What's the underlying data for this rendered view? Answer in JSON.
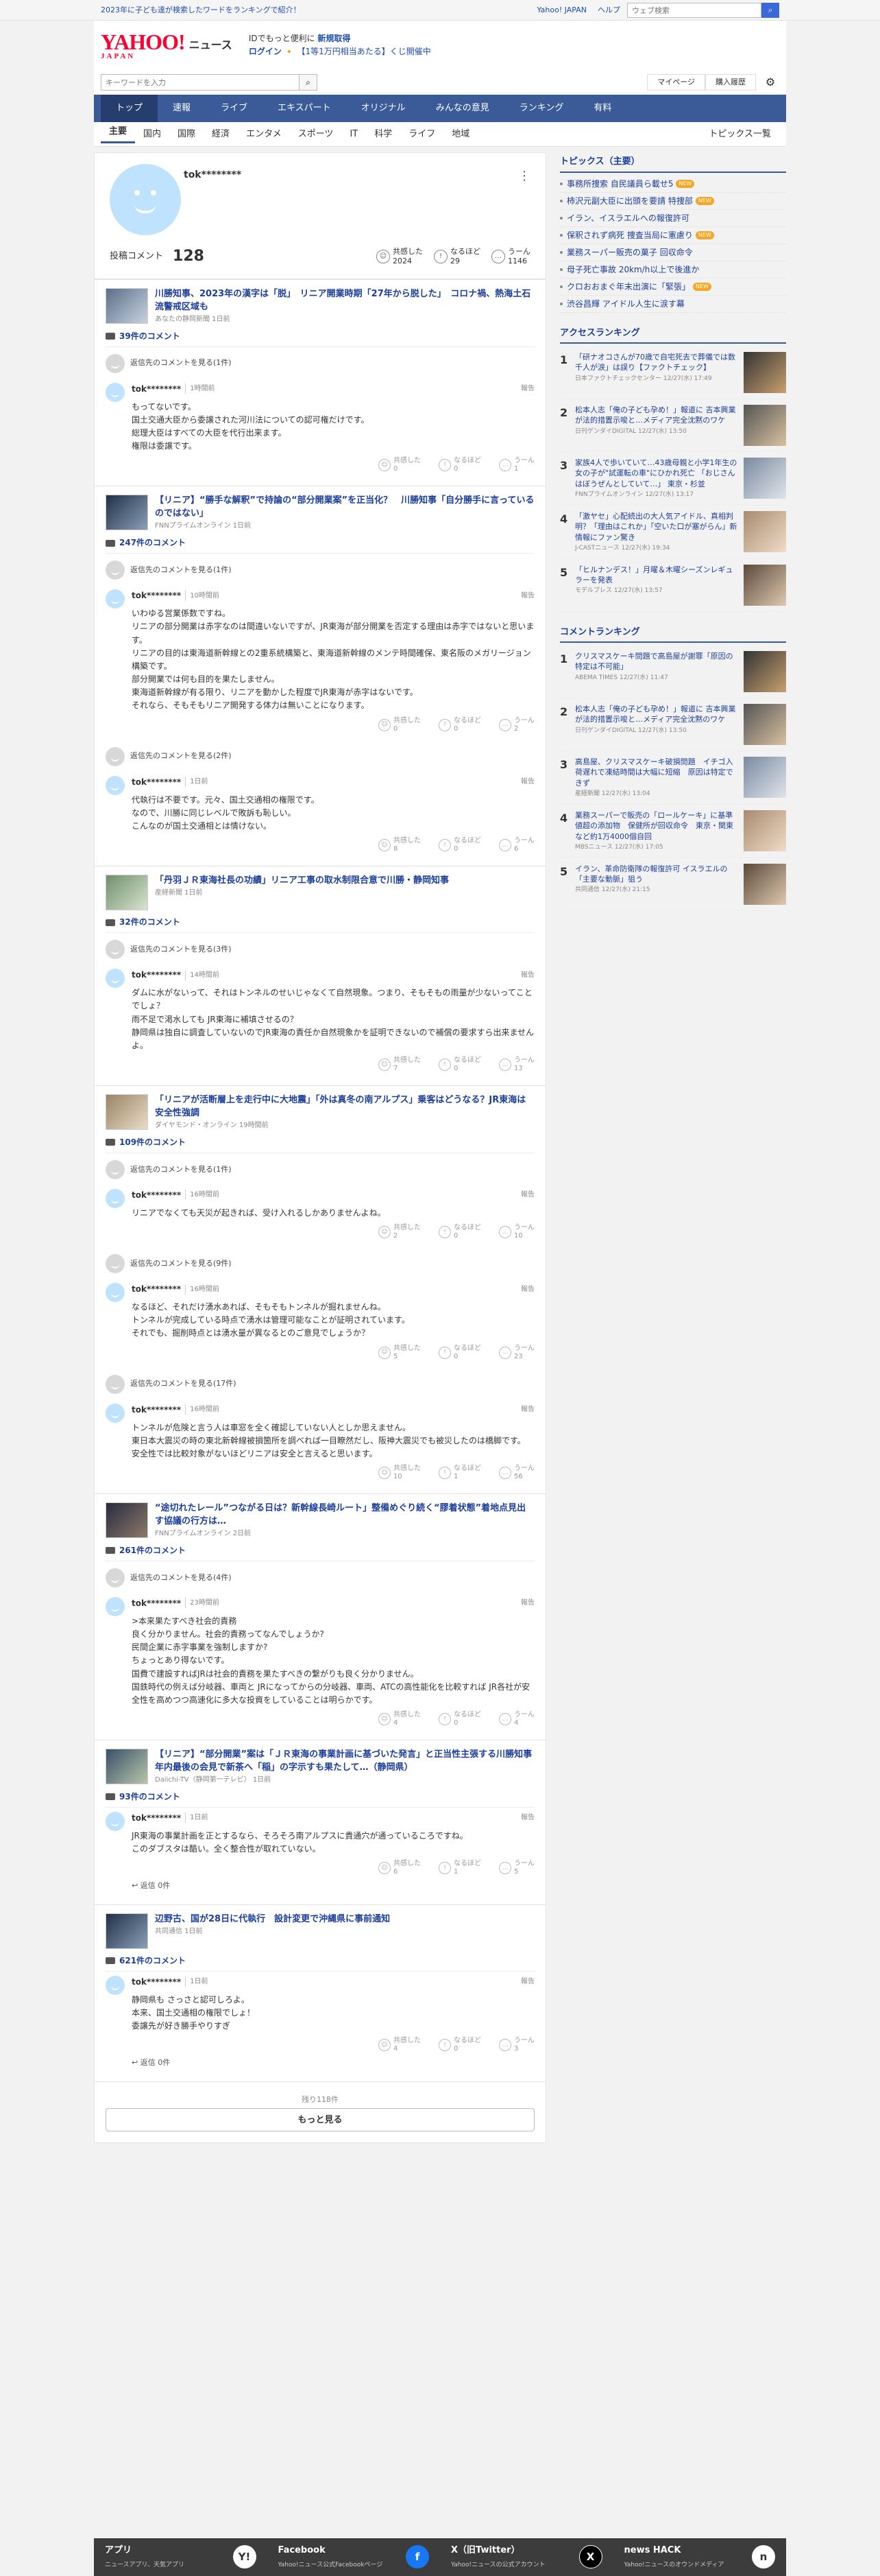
{
  "topbar": {
    "promo": "2023年に子ども達が検索したワードをランキングで紹介！",
    "links": [
      "Yahoo! JAPAN",
      "ヘルプ"
    ],
    "search_placeholder": "ウェブ検索",
    "search_btn": "検索"
  },
  "header": {
    "logo": "YAHOO!",
    "logo_sub": "JAPAN",
    "service": "ニュース",
    "promo_l1a": "IDでもっと便利に",
    "promo_l1b": "新規取得",
    "promo_l2a": "ログイン",
    "promo_l2b": "【1等1万円相当あたる】くじ開催中"
  },
  "searchrow": {
    "placeholder": "キーワードを入力",
    "mypage": "マイページ",
    "purchase": "購入履歴"
  },
  "nav": [
    "トップ",
    "速報",
    "ライブ",
    "エキスパート",
    "オリジナル",
    "みんなの意見",
    "ランキング",
    "有料"
  ],
  "subnav": [
    "主要",
    "国内",
    "国際",
    "経済",
    "エンタメ",
    "スポーツ",
    "IT",
    "科学",
    "ライフ",
    "地域"
  ],
  "subnav_all": "トピックス一覧",
  "profile": {
    "name": "tok********",
    "stat_label": "投稿コメント",
    "stat_count": "128",
    "r1_label": "共感した",
    "r1_val": "2024",
    "r2_label": "なるほど",
    "r2_val": "29",
    "r3_label": "うーん",
    "r3_val": "1146"
  },
  "labels": {
    "reply_view_prefix": "返信先のコメントを見る",
    "report": "報告",
    "react1": "共感した",
    "react2": "なるほど",
    "react3": "うーん",
    "reply_count": "返信 0件"
  },
  "articles": [
    {
      "title": "川勝知事、2023年の漢字は「脱」　リニア開業時期「27年から脱した」　コロナ禍、熱海土石流警戒区域も",
      "src": "あなたの静岡新聞 1日前",
      "count": "39件のコメント",
      "thread": [
        {
          "head": "(1件)",
          "user": "tok********",
          "time": "1時間前",
          "text": "もってないです。\n国土交通大臣から委譲された河川法についての認可権だけです。\n総理大臣はすべての大臣を代行出来ます。\n権限は委譲です。",
          "r": [
            "0",
            "0",
            "1"
          ]
        }
      ]
    },
    {
      "title": "【リニア】“勝手な解釈”で持論の“部分開業案”を正当化？　川勝知事「自分勝手に言っているのではない」",
      "src": "FNNプライムオンライン 1日前",
      "count": "247件のコメント",
      "thread": [
        {
          "head": "(1件)",
          "user": "tok********",
          "time": "10時間前",
          "text": "いわゆる営業係数ですね。\nリニアの部分開業は赤字なのは間違いないですが、JR東海が部分開業を否定する理由は赤字ではないと思います。\nリニアの目的は東海道新幹線との2重系統構築と、東海道新幹線のメンテ時間確保、東名阪のメガリージョン構築です。\n部分開業では何も目的を果たしません。\n東海道新幹線が有る限り、リニアを動かした程度でJR東海が赤字はないです。\nそれなら、そもそもリニア開発する体力は無いことになります。",
          "r": [
            "0",
            "0",
            "2"
          ]
        },
        {
          "head": "(2件)",
          "user": "tok********",
          "time": "1日前",
          "text": "代執行は不要です。元々、国土交通相の権限です。\nなので、川勝に同じレベルで敗訴も恥しい。\nこんなのが国土交通相とは情けない。",
          "r": [
            "8",
            "0",
            "6"
          ]
        }
      ]
    },
    {
      "title": "「丹羽ＪＲ東海社長の功績」リニア工事の取水制限合意で川勝・静岡知事",
      "src": "産経新聞 1日前",
      "count": "32件のコメント",
      "thread": [
        {
          "head": "(3件)",
          "user": "tok********",
          "time": "14時間前",
          "text": "ダムに水がないって、それはトンネルのせいじゃなくて自然現象。つまり、そもそもの雨量が少ないってことでしょ？\n雨不足で渇水しても JR東海に補填させるの？\n静岡県は独自に調査していないのでJR東海の責任か自然現象かを証明できないので補償の要求すら出来ませんよ。",
          "r": [
            "7",
            "0",
            "13"
          ]
        }
      ]
    },
    {
      "title": "「リニアが活断層上を走行中に大地震」「外は真冬の南アルプス」乗客はどうなる？JR東海は安全性強調",
      "src": "ダイヤモンド・オンライン 19時間前",
      "count": "109件のコメント",
      "thread": [
        {
          "head": "(1件)",
          "user": "tok********",
          "time": "16時間前",
          "text": "リニアでなくても天災が起きれば、受け入れるしかありませんよね。",
          "r": [
            "2",
            "0",
            "10"
          ]
        },
        {
          "head": "(9件)",
          "user": "tok********",
          "time": "16時間前",
          "text": "なるほど、それだけ湧水あれば、そもそもトンネルが掘れませんね。\nトンネルが完成している時点で湧水は管理可能なことが証明されています。\nそれでも、掘削時点とは湧水量が異なるとのご意見でしょうか？",
          "r": [
            "5",
            "0",
            "23"
          ]
        },
        {
          "head": "(17件)",
          "user": "tok********",
          "time": "16時間前",
          "text": "トンネルが危険と言う人は車窓を全く確認していない人としか思えません。\n東日本大震災の時の東北新幹線被損箇所を調べれば一目瞭然だし、阪神大震災でも被災したのは橋脚です。\n安全性では比較対象がないほどリニアは安全と言えると思います。",
          "r": [
            "10",
            "1",
            "56"
          ]
        }
      ]
    },
    {
      "title": "“途切れたレール”つながる日は？新幹線長崎ルート」整備めぐり続く“膠着状態”着地点見出す協議の行方は…",
      "src": "FNNプライムオンライン 2日前",
      "count": "261件のコメント",
      "thread": [
        {
          "head": "(4件)",
          "user": "tok********",
          "time": "23時間前",
          "text": ">本来果たすべき社会的責務\n良く分かりません。社会的責務ってなんでしょうか?\n民間企業に赤字事業を強制しますか?\nちょっとあり得ないです。\n国費で建設すればJRは社会的責務を果たすべきの繋がりも良く分かりません。\n国鉄時代の例えば分岐器、車両と JRになってからの分岐器、車両、ATCの高性能化を比較すれば JR各社が安全性を高めつつ高速化に多大な投資をしていることは明らかです。",
          "r": [
            "4",
            "0",
            "4"
          ]
        }
      ]
    },
    {
      "title": "【リニア】“部分開業”案は「ＪＲ東海の事業計画に基づいた発言」と正当性主張する川勝知事　年内最後の会見で新茶へ「稲」の字示すも果たして…（静岡県）",
      "src": "Daiichi-TV（静岡第一テレビ） 1日前",
      "count": "93件のコメント",
      "thread": [
        {
          "user": "tok********",
          "time": "1日前",
          "text": "JR東海の事業計画を正とするなら、そろそろ南アルプスに貴通穴が通っているころですね。\nこのダブスタは酷い。全く整合性が取れていない。",
          "r": [
            "6",
            "1",
            "5"
          ]
        }
      ]
    },
    {
      "title": "辺野古、国が28日に代執行　設計変更で沖縄県に事前通知",
      "src": "共同通信 1日前",
      "count": "621件のコメント",
      "thread": [
        {
          "user": "tok********",
          "time": "1日前",
          "text": "静岡県も さっさと認可しろよ。\n本来、国土交通相の権限でしょ！\n委譲先が好き勝手やりすぎ",
          "r": [
            "4",
            "0",
            "3"
          ]
        }
      ]
    }
  ],
  "more": {
    "rest": "残り118件",
    "button": "もっと見る"
  },
  "side": {
    "topics_title": "トピックス（主要）",
    "topics": [
      {
        "t": "事務所捜索 自民議員ら載せ5",
        "badge": "NEW"
      },
      {
        "t": "柿沢元副大臣に出頭を要請 特捜部",
        "badge": "NEW"
      },
      {
        "t": "イラン、イスラエルへの報復許可",
        "badge": ""
      },
      {
        "t": "保釈されず病死 捜査当局に憲慮り",
        "badge": "NEW"
      },
      {
        "t": "業務スーパー販売の菓子 回収命令",
        "badge": ""
      },
      {
        "t": "母子死亡事故 20km/h以上で後進か",
        "badge": ""
      },
      {
        "t": "クロおおまぐ年末出演に「緊張」",
        "badge": "NEW"
      },
      {
        "t": "渋谷昌輝 アイドル人生に涙す幕",
        "badge": ""
      }
    ],
    "access_title": "アクセスランキング",
    "access": [
      {
        "n": "1",
        "t": "「研ナオコさんが70歳で自宅死去で葬儀では数千人が涙」は誤り【ファクトチェック】",
        "m": "日本ファクトチェックセンター 12/27(水) 17:49"
      },
      {
        "n": "2",
        "t": "松本人志「俺の子ども孕め！」報道に 吉本興業が法的措置示唆と…メディア完全沈黙のワケ",
        "m": "日刊ゲンダイDIGITAL 12/27(水) 13:50"
      },
      {
        "n": "3",
        "t": "家族4人で歩いていて…43歳母親と小学1年生の女の子が\"試運転の車\"にひかれ死亡 「おじさんはぼうぜんとしていて…」 東京・杉並",
        "m": "FNNプライムオンライン 12/27(水) 13:17"
      },
      {
        "n": "4",
        "t": "「激ヤセ」心配続出の大人気アイドル、真相判明？「理由はこれか」「空いた口が塞がらん」新情報にファン驚き",
        "m": "J-CASTニュース 12/27(水) 19:34"
      },
      {
        "n": "5",
        "t": "「ヒルナンデス！」月曜＆木曜シーズンレギュラーを発表",
        "m": "モデルプレス 12/27(水) 13:57"
      }
    ],
    "comment_title": "コメントランキング",
    "comment": [
      {
        "n": "1",
        "t": "クリスマスケーキ問題で高島屋が謝罪「原因の特定は不可能」",
        "m": "ABEMA TIMES 12/27(水) 11:47"
      },
      {
        "n": "2",
        "t": "松本人志「俺の子ども孕め！」報道に 吉本興業が法的措置示唆と…メディア完全沈黙のワケ",
        "m": "日刊ゲンダイDIGITAL 12/27(水) 13:50"
      },
      {
        "n": "3",
        "t": "高島屋、クリスマスケーキ破損問題　イチゴ入荷遅れで凍結時間は大幅に短縮　原因は特定できず",
        "m": "産経新聞 12/27(水) 13:04"
      },
      {
        "n": "4",
        "t": "業務スーパーで販売の「ロールケーキ」に基準値超の添加物　保健所が回収命令　東京・関東など約1万4000個自回",
        "m": "MBSニュース 12/27(水) 17:05"
      },
      {
        "n": "5",
        "t": "イラン、革命防衛隊の報復許可 イスラエルの「主要な動脈」狙う",
        "m": "共同通信 12/27(水) 21:15"
      }
    ]
  },
  "footer": [
    {
      "t": "アプリ",
      "s": "ニュースアプリ、天気アプリ",
      "i": "Y!"
    },
    {
      "t": "Facebook",
      "s": "Yahoo!ニュース公式Facebookページ",
      "i": "f"
    },
    {
      "t": "X（旧Twitter）",
      "s": "Yahoo!ニュースの公式アカウント",
      "i": "X"
    },
    {
      "t": "news HACK",
      "s": "Yahoo!ニュースのオウンドメディア",
      "i": "n"
    }
  ]
}
